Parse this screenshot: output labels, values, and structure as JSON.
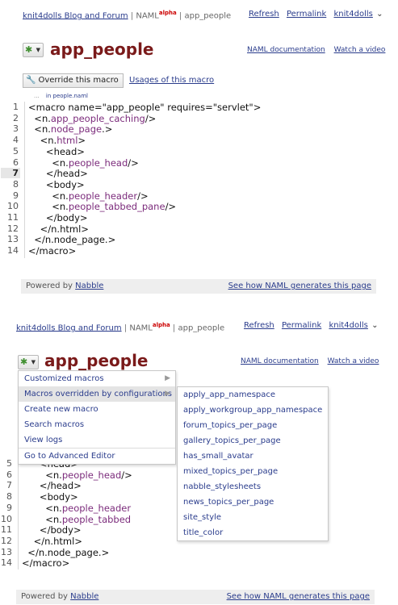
{
  "header": {
    "blog_link": "knit4dolls Blog and Forum",
    "separator": "|",
    "naml": "NAML",
    "alpha": "alpha",
    "section": "app_people",
    "refresh": "Refresh",
    "permalink": "Permalink",
    "user": "knit4dolls",
    "user_caret": "⌄"
  },
  "page": {
    "title": "app_people",
    "naml_doc": "NAML documentation",
    "watch_video": "Watch a video",
    "override_button": "Override this macro",
    "usages_link": "Usages of this macro",
    "file_prefix": "...",
    "file_name": "in people.naml"
  },
  "code": {
    "line_numbers": [
      "1",
      "2",
      "3",
      "4",
      "5",
      "6",
      "7",
      "8",
      "9",
      "10",
      "11",
      "12",
      "13",
      "14"
    ],
    "highlighted_line": "7",
    "lines": [
      {
        "pre": "<macro name=\"app_people\" requires=\"servlet\">",
        "tag": "",
        "post": ""
      },
      {
        "pre": "  <n.",
        "tag": "app_people_caching",
        "post": "/>"
      },
      {
        "pre": "  <n.",
        "tag": "node_page",
        "post": ".>"
      },
      {
        "pre": "    <n.",
        "tag": "html",
        "post": ">"
      },
      {
        "pre": "      <head>",
        "tag": "",
        "post": ""
      },
      {
        "pre": "        <n.",
        "tag": "people_head",
        "post": "/>"
      },
      {
        "pre": "      </head>",
        "tag": "",
        "post": ""
      },
      {
        "pre": "      <body>",
        "tag": "",
        "post": ""
      },
      {
        "pre": "        <n.",
        "tag": "people_header",
        "post": "/>"
      },
      {
        "pre": "        <n.",
        "tag": "people_tabbed_pane",
        "post": "/>"
      },
      {
        "pre": "      </body>",
        "tag": "",
        "post": ""
      },
      {
        "pre": "    </n.html>",
        "tag": "",
        "post": ""
      },
      {
        "pre": "  </n.node_page.>",
        "tag": "",
        "post": ""
      },
      {
        "pre": "</macro>",
        "tag": "",
        "post": ""
      }
    ],
    "partial_lines": [
      {
        "pre": "      <head>",
        "tag": "",
        "post": ""
      },
      {
        "pre": "        <n.",
        "tag": "people_head",
        "post": "/>"
      },
      {
        "pre": "      </head>",
        "tag": "",
        "post": ""
      },
      {
        "pre": "      <body>",
        "tag": "",
        "post": ""
      },
      {
        "pre": "        <n.",
        "tag": "people_header",
        "post": ""
      },
      {
        "pre": "        <n.",
        "tag": "people_tabbed",
        "post": ""
      },
      {
        "pre": "      </body>",
        "tag": "",
        "post": ""
      },
      {
        "pre": "    </n.html>",
        "tag": "",
        "post": ""
      },
      {
        "pre": "  </n.node_page.>",
        "tag": "",
        "post": ""
      },
      {
        "pre": "</macro>",
        "tag": "",
        "post": ""
      }
    ],
    "partial_line_numbers": [
      "5",
      "6",
      "7",
      "8",
      "9",
      "10",
      "11",
      "12",
      "13",
      "14"
    ]
  },
  "footer": {
    "powered_by": "Powered by",
    "nabble": "Nabble",
    "see_how": "See how NAML generates this page"
  },
  "menu": {
    "items": [
      "Customized macros",
      "Macros overridden by configurations",
      "Create new macro",
      "Search macros",
      "View logs",
      "Go to Advanced Editor"
    ],
    "submenu": [
      "apply_app_namespace",
      "apply_workgroup_app_namespace",
      "forum_topics_per_page",
      "gallery_topics_per_page",
      "has_small_avatar",
      "mixed_topics_per_page",
      "nabble_stylesheets",
      "news_topics_per_page",
      "site_style",
      "title_color"
    ]
  }
}
